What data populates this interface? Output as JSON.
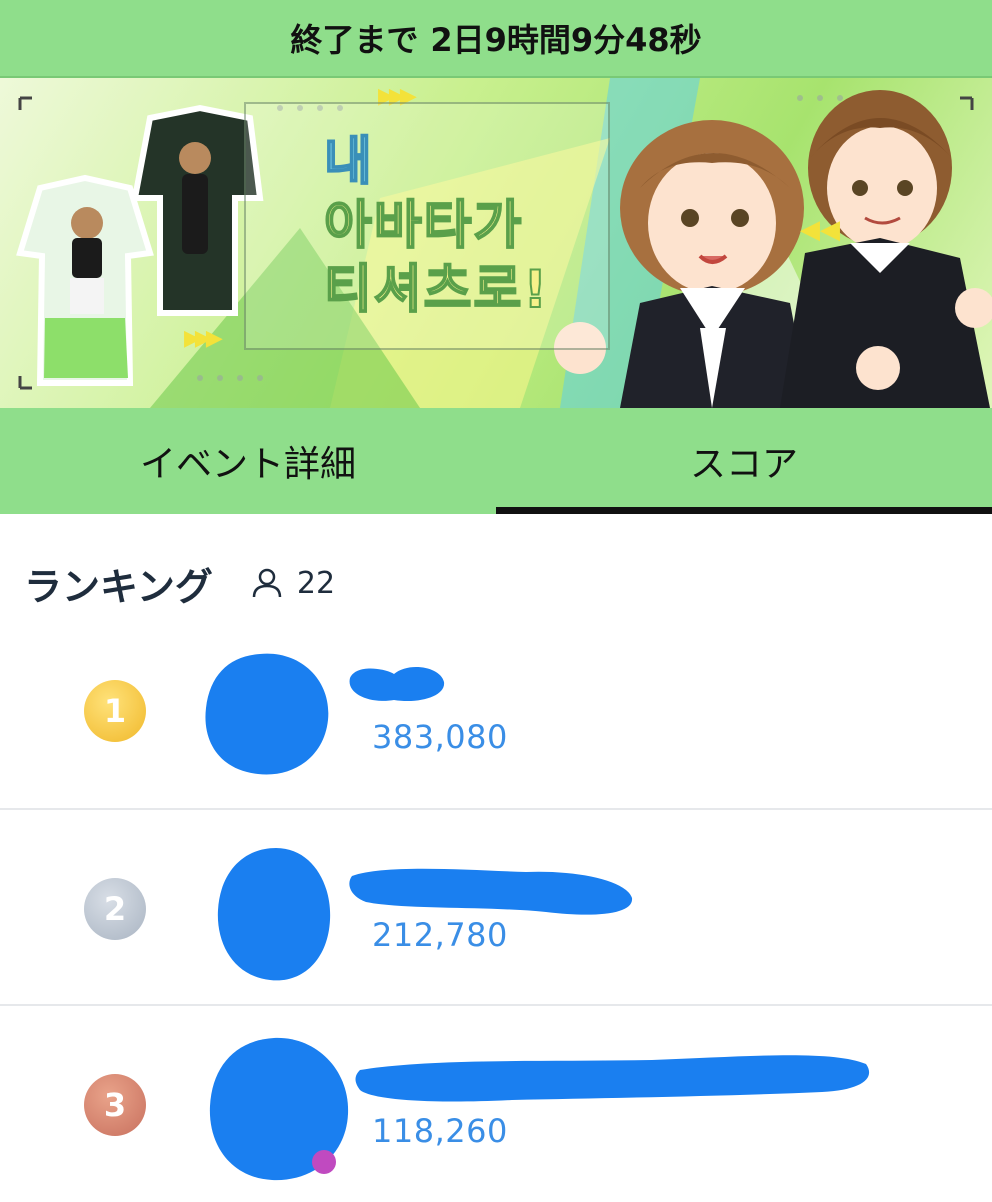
{
  "countdown": {
    "label": "終了まで",
    "remaining": "2日9時間9分48秒"
  },
  "banner": {
    "headline_lines": [
      "내",
      "아바타가",
      "티셔츠로!"
    ]
  },
  "tabs": [
    {
      "label": "イベント詳細",
      "active": false
    },
    {
      "label": "スコア",
      "active": true
    }
  ],
  "ranking": {
    "title": "ランキング",
    "participant_icon": "person-icon",
    "participant_count": "22",
    "entries": [
      {
        "rank": "1",
        "medal": "gold",
        "score": "383,080"
      },
      {
        "rank": "2",
        "medal": "silver",
        "score": "212,780"
      },
      {
        "rank": "3",
        "medal": "bronze",
        "score": "118,260"
      }
    ]
  },
  "colors": {
    "header_green": "#8fde8b",
    "score_blue": "#3a8ee6",
    "redaction_blue": "#1a7ff0"
  }
}
